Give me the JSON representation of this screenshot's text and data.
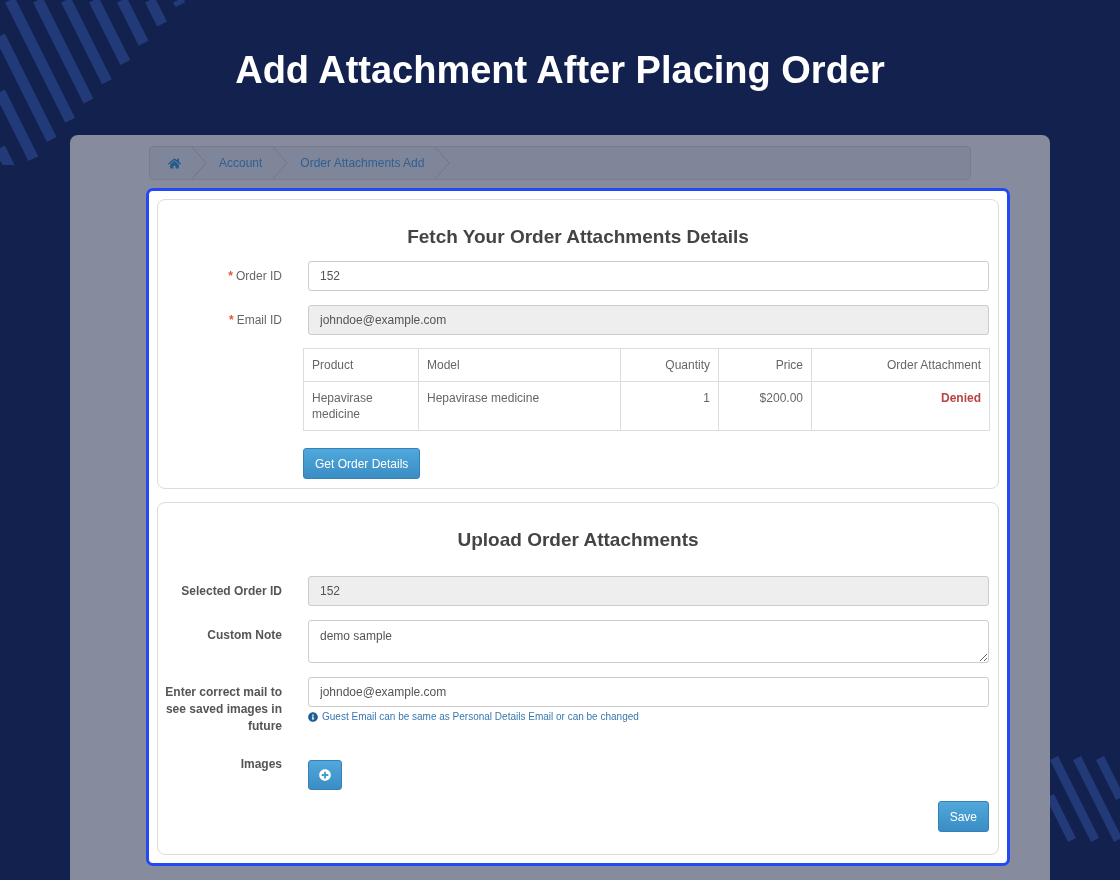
{
  "page": {
    "title": "Add Attachment After Placing Order"
  },
  "breadcrumb": [
    {
      "kind": "home"
    },
    {
      "kind": "link",
      "label": "Account"
    },
    {
      "kind": "link",
      "label": "Order Attachments Add"
    }
  ],
  "fetch_section": {
    "title": "Fetch Your Order Attachments Details",
    "fields": [
      {
        "label": "Order ID",
        "required_mark": "*",
        "value": "152",
        "disabled": false
      },
      {
        "label": "Email ID",
        "required_mark": "*",
        "value": "johndoe@example.com",
        "disabled": true
      }
    ],
    "table": {
      "columns": [
        {
          "label": "Product",
          "kind": "text"
        },
        {
          "label": "Model",
          "kind": "text"
        },
        {
          "label": "Quantity",
          "kind": "number"
        },
        {
          "label": "Price",
          "kind": "number"
        },
        {
          "label": "Order Attachment",
          "kind": "status"
        }
      ],
      "rows": [
        {
          "cells": [
            "Hepavirase medicine",
            "Hepavirase medicine",
            "1",
            "$200.00",
            "Denied"
          ]
        }
      ]
    },
    "button": "Get Order Details"
  },
  "upload_section": {
    "title": "Upload Order Attachments",
    "fields": [
      {
        "kind": "input",
        "label": "Selected Order ID",
        "value": "152",
        "disabled": true
      },
      {
        "kind": "textarea",
        "label": "Custom Note",
        "value": "demo sample",
        "disabled": false
      },
      {
        "kind": "input",
        "label": "Enter correct mail to see saved images in future",
        "value": "johndoe@example.com",
        "disabled": false,
        "help": "Guest Email can be same as Personal Details Email or can be changed"
      },
      {
        "kind": "add_button",
        "label": "Images"
      }
    ],
    "save_button": "Save"
  }
}
